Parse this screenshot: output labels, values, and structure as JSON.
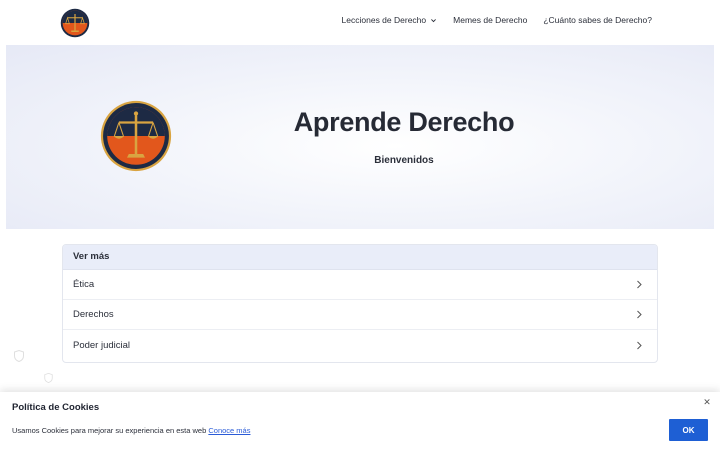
{
  "nav": {
    "items": [
      {
        "label": "Lecciones de Derecho",
        "has_dropdown": true
      },
      {
        "label": "Memes de Derecho",
        "has_dropdown": false
      },
      {
        "label": "¿Cuánto sabes de Derecho?",
        "has_dropdown": false
      }
    ]
  },
  "hero": {
    "title": "Aprende Derecho",
    "subtitle": "Bienvenidos"
  },
  "card": {
    "header": "Ver más",
    "items": [
      {
        "label": "Ética"
      },
      {
        "label": "Derechos"
      },
      {
        "label": "Poder judicial"
      }
    ]
  },
  "cookie": {
    "title": "Política de Cookies",
    "text": "Usamos Cookies para mejorar su experiencia en esta web",
    "link": "Conoce más",
    "ok_label": "OK",
    "close_icon": "close-icon"
  },
  "colors": {
    "accent": "#1e5fd4",
    "logo_orange": "#e2571c",
    "logo_navy": "#1d2a44",
    "logo_gold": "#d9a441",
    "card_header_bg": "#e9edf9"
  }
}
